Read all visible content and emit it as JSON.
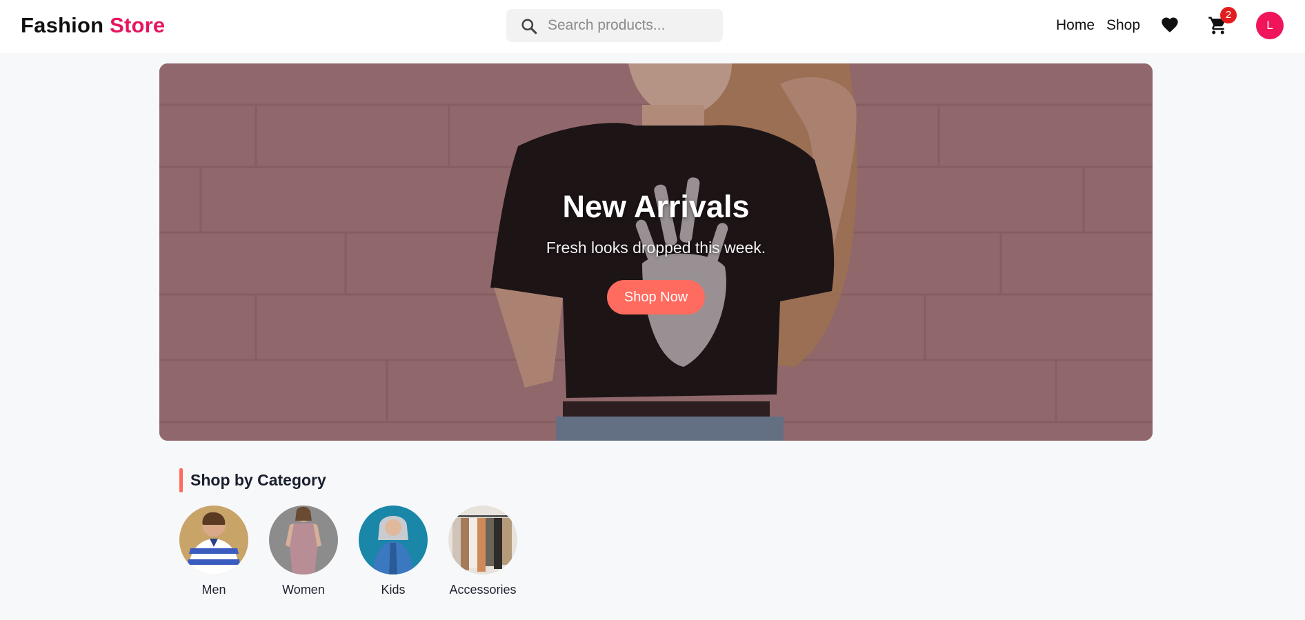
{
  "header": {
    "logo_part1": "Fashion",
    "logo_part2": "Store",
    "search_placeholder": "Search products...",
    "nav": {
      "home": "Home",
      "shop": "Shop"
    },
    "cart_count": "2",
    "avatar_initial": "L"
  },
  "hero": {
    "title": "New Arrivals",
    "subtitle": "Fresh looks dropped this week.",
    "cta": "Shop Now"
  },
  "categories": {
    "heading": "Shop by Category",
    "items": [
      {
        "label": "Men"
      },
      {
        "label": "Women"
      },
      {
        "label": "Kids"
      },
      {
        "label": "Accessories"
      }
    ]
  },
  "colors": {
    "brand": "#e6155f",
    "accent": "#ff6b5e",
    "badge": "#e11d1d",
    "page_bg": "#f7f8fa"
  },
  "icons": [
    "search-icon",
    "heart-icon",
    "cart-icon"
  ]
}
